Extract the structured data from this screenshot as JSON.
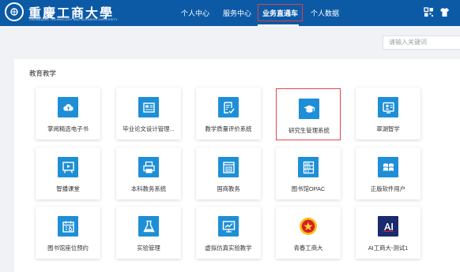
{
  "header": {
    "nav": [
      "个人中心",
      "服务中心",
      "业务直通车",
      "个人数据"
    ],
    "active_nav": "业务直通车",
    "accent": "#0c5aa6"
  },
  "search": {
    "placeholder": "请输入关键词"
  },
  "section": {
    "title": "教育教学"
  },
  "apps": [
    {
      "label": "掌阅精选电子书",
      "icon": "cloud-icon"
    },
    {
      "label": "毕业论文设计管理...",
      "icon": "thesis-icon"
    },
    {
      "label": "教学质量评价系统",
      "icon": "evaluation-icon"
    },
    {
      "label": "研究生管理系统",
      "icon": "graduate-cap-icon",
      "selected": true
    },
    {
      "label": "翠湖智学",
      "icon": "learning-icon"
    },
    {
      "label": "智播课堂",
      "icon": "classroom-icon"
    },
    {
      "label": "本科教务系统",
      "icon": "printer-icon"
    },
    {
      "label": "国商教务",
      "icon": "window-icon"
    },
    {
      "label": "图书馆OPAC",
      "icon": "bookshelf-icon"
    },
    {
      "label": "正版软件用户",
      "icon": "windows-icon"
    },
    {
      "label": "图书馆座位预约",
      "icon": "calendar-icon"
    },
    {
      "label": "实验管理",
      "icon": "lab-flask-icon"
    },
    {
      "label": "虚拟仿真实验教学",
      "icon": "monitor-chart-icon"
    },
    {
      "label": "青春工商大",
      "icon": "youth-league-icon"
    },
    {
      "label": "AI工商大-测试1",
      "icon": "ai-logo-icon"
    }
  ]
}
